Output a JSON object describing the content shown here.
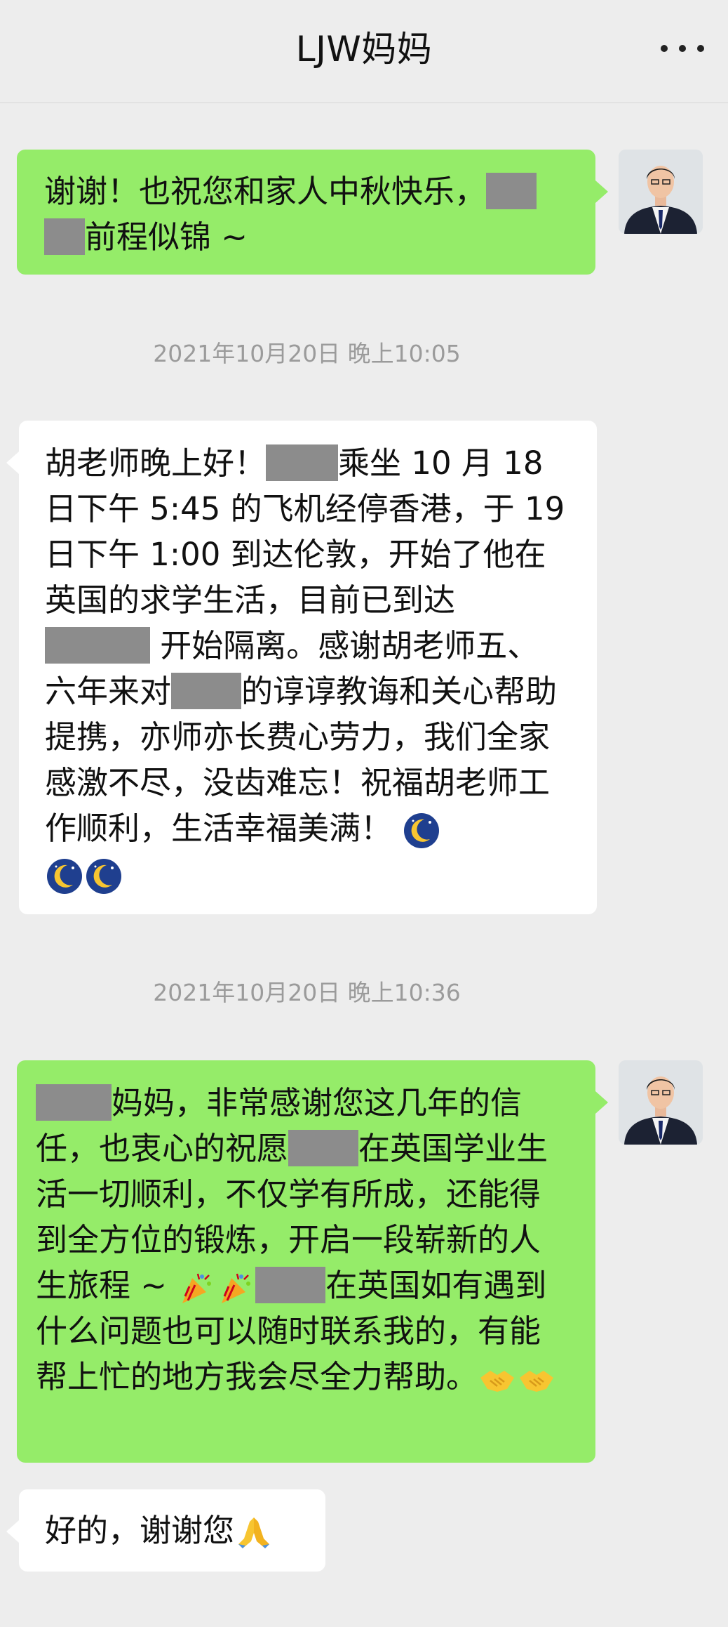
{
  "header": {
    "title": "LJW妈妈",
    "more_icon": "more-dots-icon"
  },
  "messages": [
    {
      "side": "right",
      "parts": [
        "谢谢！也祝您和家人中秋快乐，",
        "",
        "",
        "前程似锦 ~"
      ]
    },
    {
      "timestamp": "2021年10月20日 晚上10:05"
    },
    {
      "side": "left",
      "parts": [
        "胡老师晚上好！",
        "",
        "乘坐 10 月 18 日下午 5:45 的飞机经停香港，于 19 日下午 1:00 到达伦敦，开始了他在英国的求学生活，目前已到达",
        "",
        " 开始隔离。感谢胡老师五、六年来对",
        "",
        "的谆谆教诲和关心帮助提携，亦师亦长费心劳力，我们全家感激不尽，没齿难忘！祝福胡老师工作顺利，生活幸福美满！"
      ],
      "emoji": "moon-face-emoji"
    },
    {
      "timestamp": "2021年10月20日 晚上10:36"
    },
    {
      "side": "right",
      "parts": [
        "",
        "妈妈，非常感谢您这几年的信任，也衷心的祝愿",
        "",
        "在英国学业生活一切顺利，不仅学有所成，还能得到全方位的锻炼，开启一段崭新的人生旅程 ~ ",
        "",
        "在英国如有遇到什么问题也可以随时联系我的，有能帮上忙的地方我会尽全力帮助。"
      ],
      "emoji_party": "party-popper-emoji",
      "emoji_handshake": "handshake-emoji"
    },
    {
      "side": "left",
      "parts": [
        "好的，谢谢您"
      ],
      "emoji": "folded-hands-emoji"
    }
  ],
  "colors": {
    "sent_bubble": "#95ec69",
    "received_bubble": "#ffffff",
    "background": "#ededed",
    "timestamp": "#9b9b9b"
  }
}
